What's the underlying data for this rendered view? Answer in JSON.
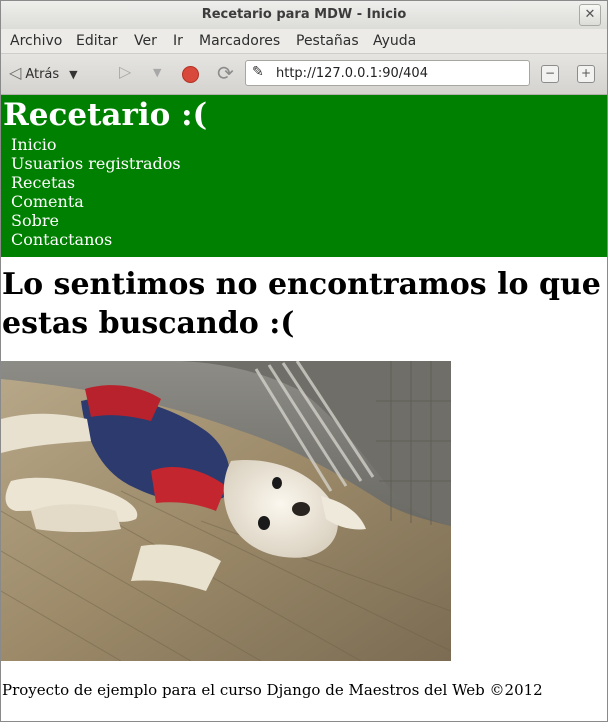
{
  "window": {
    "title": "Recetario para MDW - Inicio",
    "close_glyph": "✕"
  },
  "menubar": [
    "Archivo",
    "Editar",
    "Ver",
    "Ir",
    "Marcadores",
    "Pestañas",
    "Ayuda"
  ],
  "toolbar": {
    "back_label": "Atrás",
    "back_icon": "back-arrow-icon",
    "forward_icon": "forward-arrow-icon",
    "stop_icon": "stop-icon",
    "reload_icon": "reload-icon",
    "url": "http://127.0.0.1:90/404",
    "zoom_out_glyph": "−",
    "zoom_in_glyph": "+"
  },
  "page": {
    "site_title": "Recetario :(",
    "nav": [
      "Inicio",
      "Usuarios registrados",
      "Recetas",
      "Comenta",
      "Sobre",
      "Contactanos"
    ],
    "heading": "Lo sentimos no encontramos lo que estas buscando :(",
    "footer": "Proyecto de ejemplo para el curso Django de Maestros del Web ©2012",
    "header_color": "#008000"
  }
}
